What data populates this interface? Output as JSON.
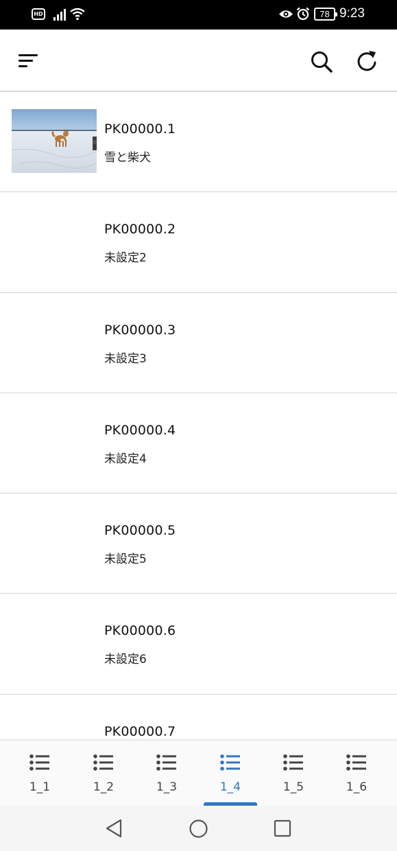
{
  "status_bar": {
    "hd_label": "HD",
    "battery_level": "78",
    "time": "9:23"
  },
  "app_bar": {
    "icons": [
      "sort-icon",
      "search-icon",
      "refresh-icon"
    ]
  },
  "list": {
    "items": [
      {
        "title": "PK00000.1",
        "subtitle": "雪と柴犬",
        "has_thumbnail": true
      },
      {
        "title": "PK00000.2",
        "subtitle": "未設定2",
        "has_thumbnail": false
      },
      {
        "title": "PK00000.3",
        "subtitle": "未設定3",
        "has_thumbnail": false
      },
      {
        "title": "PK00000.4",
        "subtitle": "未設定4",
        "has_thumbnail": false
      },
      {
        "title": "PK00000.5",
        "subtitle": "未設定5",
        "has_thumbnail": false
      },
      {
        "title": "PK00000.6",
        "subtitle": "未設定6",
        "has_thumbnail": false
      },
      {
        "title": "PK00000.7",
        "subtitle": "",
        "has_thumbnail": false
      }
    ]
  },
  "bottom_nav": {
    "active_index": 3,
    "tabs": [
      {
        "label": "1_1",
        "icon": "list-icon"
      },
      {
        "label": "1_2",
        "icon": "list-icon"
      },
      {
        "label": "1_3",
        "icon": "list-icon"
      },
      {
        "label": "1_4",
        "icon": "list-icon"
      },
      {
        "label": "1_5",
        "icon": "list-icon"
      },
      {
        "label": "1_6",
        "icon": "list-icon"
      }
    ]
  },
  "colors": {
    "accent": "#2f78c4",
    "status_bar_bg": "#000000",
    "divider": "#d6d6d6"
  }
}
